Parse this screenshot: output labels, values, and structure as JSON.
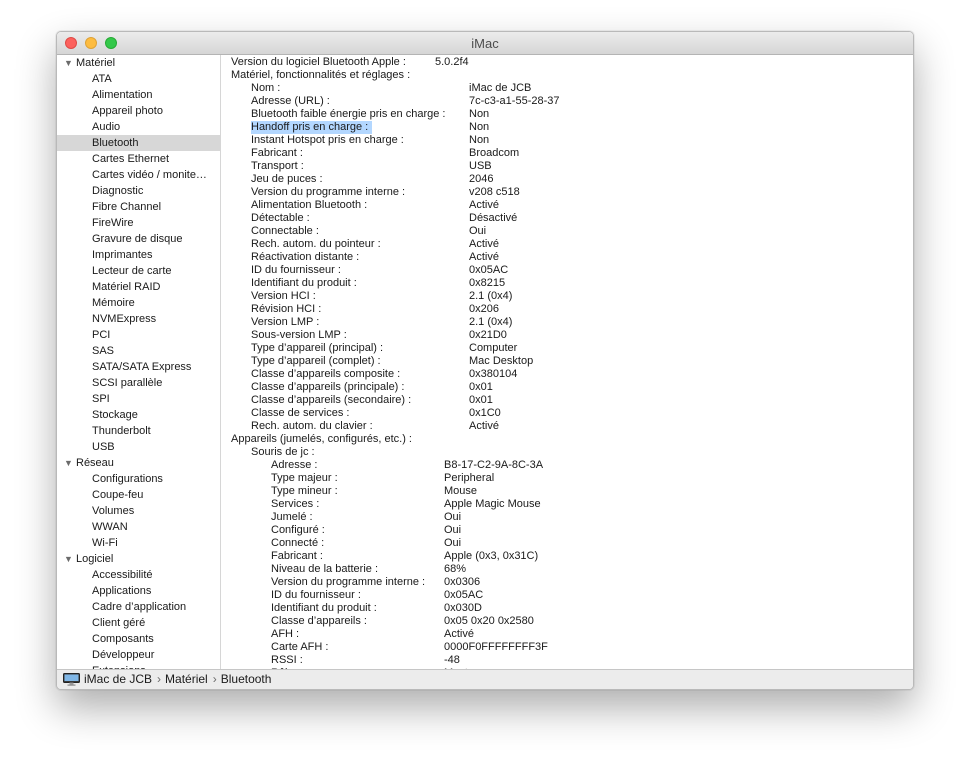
{
  "window": {
    "title": "iMac"
  },
  "sidebar": {
    "groups": [
      {
        "label": "Matériel",
        "items": [
          "ATA",
          "Alimentation",
          "Appareil photo",
          "Audio",
          "Bluetooth",
          "Cartes Ethernet",
          "Cartes vidéo / monite…",
          "Diagnostic",
          "Fibre Channel",
          "FireWire",
          "Gravure de disque",
          "Imprimantes",
          "Lecteur de carte",
          "Matériel RAID",
          "Mémoire",
          "NVMExpress",
          "PCI",
          "SAS",
          "SATA/SATA Express",
          "SCSI parallèle",
          "SPI",
          "Stockage",
          "Thunderbolt",
          "USB"
        ]
      },
      {
        "label": "Réseau",
        "items": [
          "Configurations",
          "Coupe-feu",
          "Volumes",
          "WWAN",
          "Wi-Fi"
        ]
      },
      {
        "label": "Logiciel",
        "items": [
          "Accessibilité",
          "Applications",
          "Cadre d’application",
          "Client géré",
          "Composants",
          "Développeur",
          "Extensions"
        ]
      }
    ],
    "selected": "Bluetooth"
  },
  "content": {
    "rows": [
      {
        "level": 0,
        "key": "Version du logiciel Bluetooth Apple :",
        "value": "5.0.2f4"
      },
      {
        "level": 0,
        "key": "Matériel, fonctionnalités et réglages :",
        "value": ""
      },
      {
        "level": 1,
        "key": "Nom :",
        "value": "iMac de JCB"
      },
      {
        "level": 1,
        "key": "Adresse (URL) :",
        "value": "7c-c3-a1-55-28-37"
      },
      {
        "level": 1,
        "key": "Bluetooth faible énergie pris en charge :",
        "value": "Non"
      },
      {
        "level": 1,
        "key": "Handoff pris en charge :",
        "value": "Non",
        "highlighted": true
      },
      {
        "level": 1,
        "key": "Instant Hotspot pris en charge :",
        "value": "Non"
      },
      {
        "level": 1,
        "key": "Fabricant :",
        "value": "Broadcom"
      },
      {
        "level": 1,
        "key": "Transport :",
        "value": "USB"
      },
      {
        "level": 1,
        "key": "Jeu de puces :",
        "value": "2046"
      },
      {
        "level": 1,
        "key": "Version du programme interne :",
        "value": "v208 c518"
      },
      {
        "level": 1,
        "key": "Alimentation Bluetooth :",
        "value": "Activé"
      },
      {
        "level": 1,
        "key": "Détectable :",
        "value": "Désactivé"
      },
      {
        "level": 1,
        "key": "Connectable :",
        "value": "Oui"
      },
      {
        "level": 1,
        "key": "Rech. autom. du pointeur :",
        "value": "Activé"
      },
      {
        "level": 1,
        "key": "Réactivation distante :",
        "value": "Activé"
      },
      {
        "level": 1,
        "key": "ID du fournisseur :",
        "value": "0x05AC"
      },
      {
        "level": 1,
        "key": "Identifiant du produit :",
        "value": "0x8215"
      },
      {
        "level": 1,
        "key": "Version HCI :",
        "value": "2.1 (0x4)"
      },
      {
        "level": 1,
        "key": "Révision HCI :",
        "value": "0x206"
      },
      {
        "level": 1,
        "key": "Version LMP :",
        "value": "2.1 (0x4)"
      },
      {
        "level": 1,
        "key": "Sous-version LMP :",
        "value": "0x21D0"
      },
      {
        "level": 1,
        "key": "Type d’appareil (principal) :",
        "value": "Computer"
      },
      {
        "level": 1,
        "key": "Type d’appareil (complet) :",
        "value": "Mac Desktop"
      },
      {
        "level": 1,
        "key": "Classe d’appareils composite :",
        "value": "0x380104"
      },
      {
        "level": 1,
        "key": "Classe d’appareils (principale) :",
        "value": "0x01"
      },
      {
        "level": 1,
        "key": "Classe d’appareils (secondaire) :",
        "value": "0x01"
      },
      {
        "level": 1,
        "key": "Classe de services :",
        "value": "0x1C0"
      },
      {
        "level": 1,
        "key": "Rech. autom. du clavier :",
        "value": "Activé"
      },
      {
        "level": 0,
        "key": "Appareils (jumelés, configurés, etc.) :",
        "value": ""
      },
      {
        "level": 1,
        "key": "Souris de jc :",
        "value": ""
      },
      {
        "level": 2,
        "key": "Adresse :",
        "value": "B8-17-C2-9A-8C-3A"
      },
      {
        "level": 2,
        "key": "Type majeur :",
        "value": "Peripheral"
      },
      {
        "level": 2,
        "key": "Type mineur :",
        "value": "Mouse"
      },
      {
        "level": 2,
        "key": "Services :",
        "value": "Apple Magic Mouse"
      },
      {
        "level": 2,
        "key": "Jumelé :",
        "value": "Oui"
      },
      {
        "level": 2,
        "key": "Configuré :",
        "value": "Oui"
      },
      {
        "level": 2,
        "key": "Connecté :",
        "value": "Oui"
      },
      {
        "level": 2,
        "key": "Fabricant :",
        "value": "Apple (0x3, 0x31C)"
      },
      {
        "level": 2,
        "key": "Niveau de la batterie :",
        "value": "68%"
      },
      {
        "level": 2,
        "key": "Version du programme interne :",
        "value": "0x0306"
      },
      {
        "level": 2,
        "key": "ID du fournisseur :",
        "value": "0x05AC"
      },
      {
        "level": 2,
        "key": "Identifiant du produit :",
        "value": "0x030D"
      },
      {
        "level": 2,
        "key": "Classe d’appareils :",
        "value": "0x05 0x20 0x2580"
      },
      {
        "level": 2,
        "key": "AFH :",
        "value": "Activé"
      },
      {
        "level": 2,
        "key": "Carte AFH :",
        "value": "0000F0FFFFFFFF3F"
      },
      {
        "level": 2,
        "key": "RSSI :",
        "value": "-48"
      },
      {
        "level": 2,
        "key": "Rôle :",
        "value": "Master"
      }
    ]
  },
  "statusbar": {
    "icon": "imac-icon",
    "path": [
      "iMac de JCB",
      "Matériel",
      "Bluetooth"
    ]
  },
  "colors": {
    "selection_row": "#d7d7d7",
    "highlight": "#b3d7ff",
    "traffic_close": "#fc615d",
    "traffic_minimize": "#fdbc40",
    "traffic_maximize": "#34c84a"
  }
}
